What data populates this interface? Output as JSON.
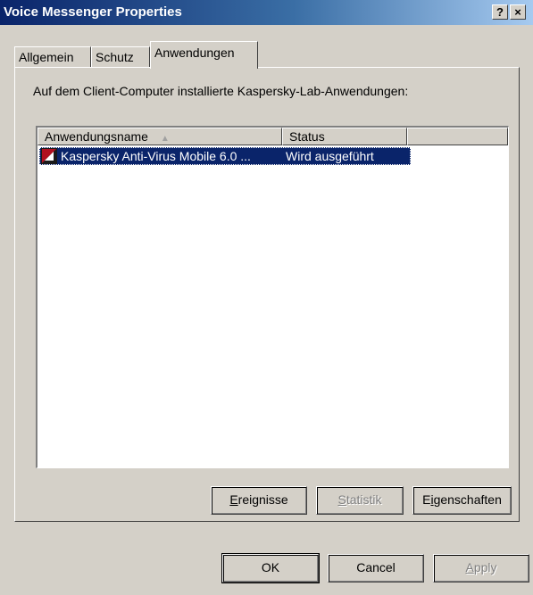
{
  "window": {
    "title": "Voice Messenger Properties",
    "help_glyph": "?",
    "close_glyph": "×"
  },
  "tabs": [
    {
      "label": "Allgemein",
      "active": false
    },
    {
      "label": "Schutz",
      "active": false
    },
    {
      "label": "Anwendungen",
      "active": true
    }
  ],
  "panel": {
    "label": "Auf dem Client-Computer installierte Kaspersky-Lab-Anwendungen:",
    "list": {
      "columns": [
        {
          "label": "Anwendungsname",
          "sort": "ascending"
        },
        {
          "label": "Status"
        }
      ],
      "rows": [
        {
          "name": "Kaspersky Anti-Virus Mobile 6.0 ...",
          "status": "Wird ausgeführt",
          "selected": true,
          "icon": "kaspersky-icon"
        }
      ]
    },
    "buttons": {
      "events": {
        "mnemonic": "E",
        "rest": "reignisse",
        "enabled": true
      },
      "statistics": {
        "mnemonic": "S",
        "rest": "tatistik",
        "enabled": false
      },
      "properties": {
        "prefix": "E",
        "mnemonic": "i",
        "rest": "genschaften",
        "enabled": true
      }
    }
  },
  "footer": {
    "ok": "OK",
    "cancel": "Cancel",
    "apply": {
      "mnemonic": "A",
      "rest": "pply",
      "enabled": false
    }
  },
  "colors": {
    "titlebar_start": "#0a246a",
    "titlebar_end": "#a6caf0",
    "selection": "#0a246a",
    "face": "#d4d0c8"
  }
}
